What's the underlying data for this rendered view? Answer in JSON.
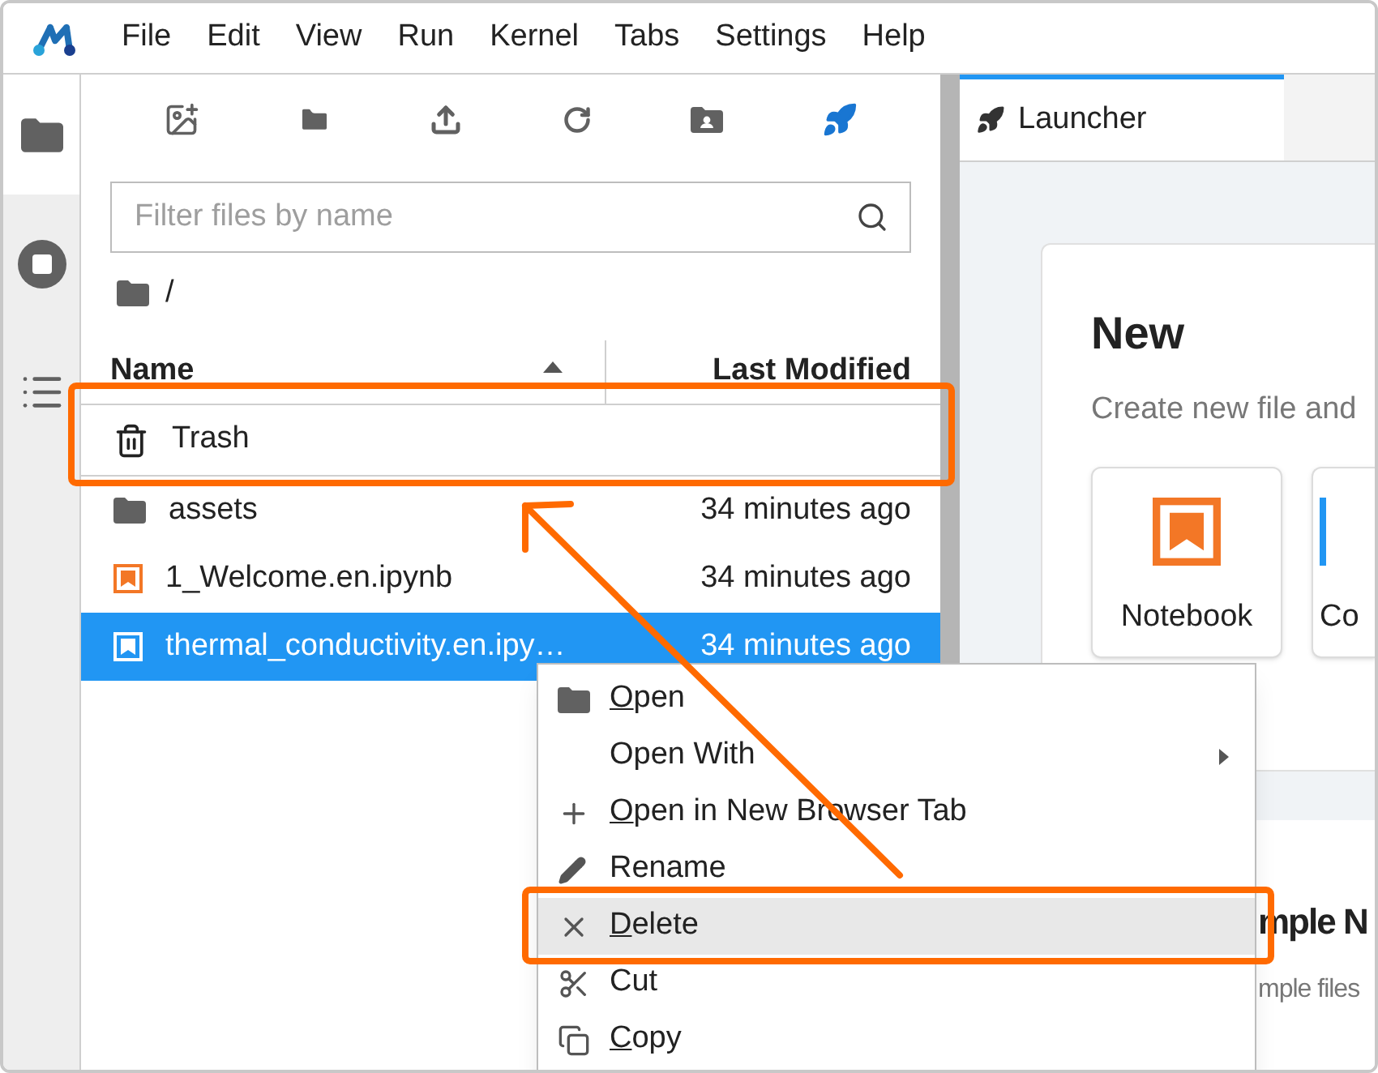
{
  "menu_bar": [
    "File",
    "Edit",
    "View",
    "Run",
    "Kernel",
    "Tabs",
    "Settings",
    "Help"
  ],
  "file_browser": {
    "filter": {
      "placeholder": "Filter files by name"
    },
    "breadcrumb": "/",
    "columns": [
      {
        "label": "Name",
        "sorted": true
      },
      {
        "label": "Last Modified",
        "sorted": false
      }
    ],
    "rows": [
      {
        "kind": "trash",
        "name": "Trash",
        "selected": false
      },
      {
        "kind": "folder",
        "name": "assets",
        "modified": "34 minutes ago",
        "selected": false
      },
      {
        "kind": "notebook",
        "name": "1_Welcome.en.ipynb",
        "modified": "34 minutes ago",
        "selected": false
      },
      {
        "kind": "notebook",
        "name": "thermal_conductivity.en.ipy…",
        "modified": "34 minutes ago",
        "selected": true
      }
    ]
  },
  "launcher": {
    "tab": "Launcher",
    "section_title": "New",
    "section_subtitle": "Create new file and",
    "tiles": [
      "Notebook",
      "Co"
    ],
    "second_title": "mple N",
    "second_subtitle": "mple files"
  },
  "context_menu": [
    {
      "label": "Open",
      "underline_first": true,
      "has_submenu": false,
      "highlighted": false
    },
    {
      "label": "Open With",
      "underline_first": false,
      "has_submenu": true,
      "highlighted": false
    },
    {
      "label": "Open in New Browser Tab",
      "underline_first": true,
      "has_submenu": false,
      "highlighted": false
    },
    {
      "label": "Rename",
      "underline_first": false,
      "has_submenu": false,
      "highlighted": false
    },
    {
      "label": "Delete",
      "underline_first": true,
      "has_submenu": false,
      "highlighted": true
    },
    {
      "label": "Cut",
      "underline_first": false,
      "has_submenu": false,
      "highlighted": false
    },
    {
      "label": "Copy",
      "underline_first": true,
      "has_submenu": false,
      "highlighted": false
    }
  ]
}
